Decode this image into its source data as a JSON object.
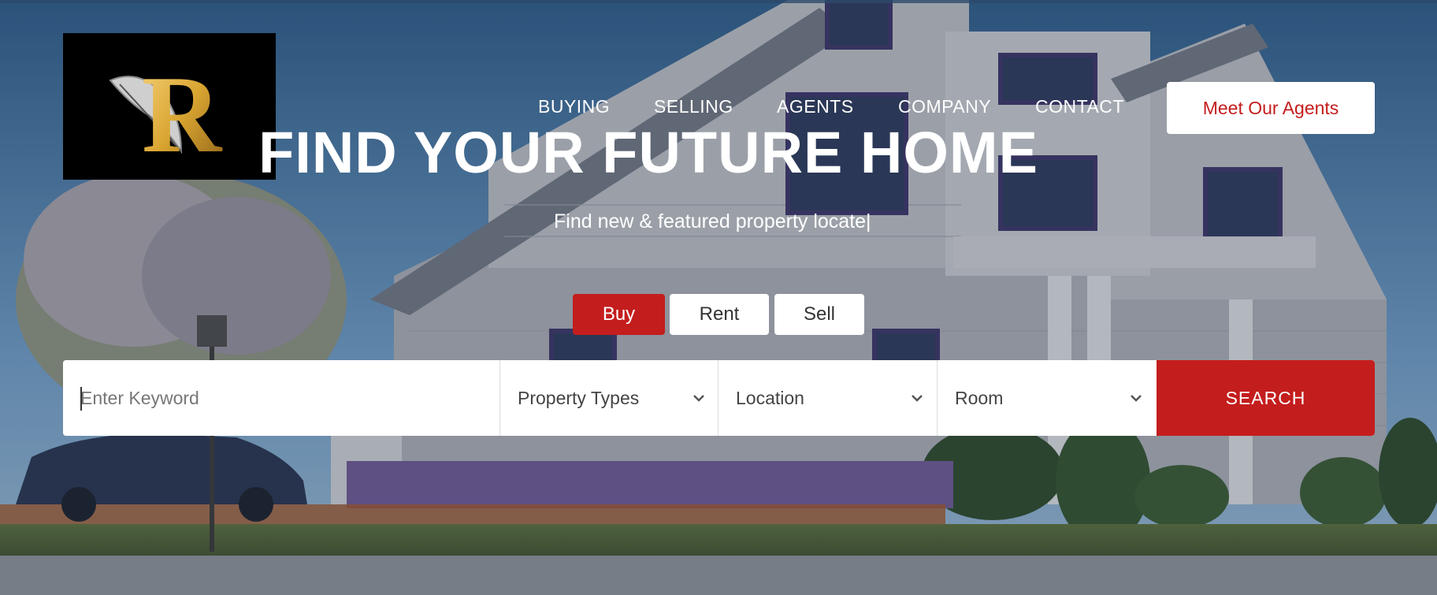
{
  "brand": {
    "logo_letter": "R"
  },
  "nav": {
    "items": [
      {
        "label": "BUYING"
      },
      {
        "label": "SELLING"
      },
      {
        "label": "AGENTS"
      },
      {
        "label": "COMPANY"
      },
      {
        "label": "CONTACT"
      }
    ],
    "cta_label": "Meet Our Agents"
  },
  "hero": {
    "title": "FIND YOUR FUTURE HOME",
    "subtitle": "Find new & featured property locate|"
  },
  "tabs": [
    {
      "label": "Buy",
      "active": true
    },
    {
      "label": "Rent",
      "active": false
    },
    {
      "label": "Sell",
      "active": false
    }
  ],
  "search": {
    "keyword_placeholder": "Enter Keyword",
    "keyword_value": "",
    "property_types": "Property Types",
    "location": "Location",
    "room": "Room",
    "button_label": "SEARCH"
  },
  "colors": {
    "accent": "#c41d1d",
    "white": "#ffffff",
    "logo_bg": "#000000",
    "logo_gold": "#d9a531"
  },
  "icons": [
    "chevron-down-icon",
    "feather-quill-icon"
  ]
}
